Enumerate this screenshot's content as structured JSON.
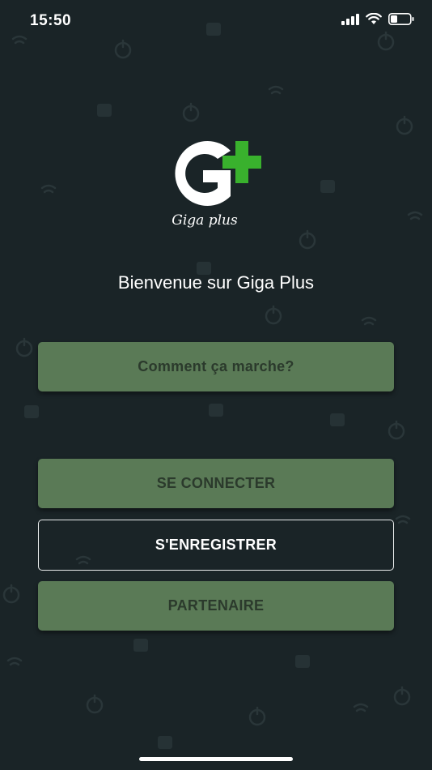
{
  "status_bar": {
    "time": "15:50",
    "icons": [
      "signal-icon",
      "wifi-icon",
      "battery-icon"
    ]
  },
  "logo": {
    "caption": "Giga plus",
    "colors": {
      "letter": "#ffffff",
      "plus": "#39b12d"
    }
  },
  "welcome_text": "Bienvenue sur Giga Plus",
  "buttons": {
    "how_it_works": "Comment ça marche?",
    "login": "SE CONNECTER",
    "register": "S'ENREGISTRER",
    "partner": "PARTENAIRE"
  },
  "colors": {
    "background": "#1a2427",
    "button_green": "#5a7a56",
    "button_text_dark": "#2b3a2c",
    "white": "#ffffff"
  }
}
